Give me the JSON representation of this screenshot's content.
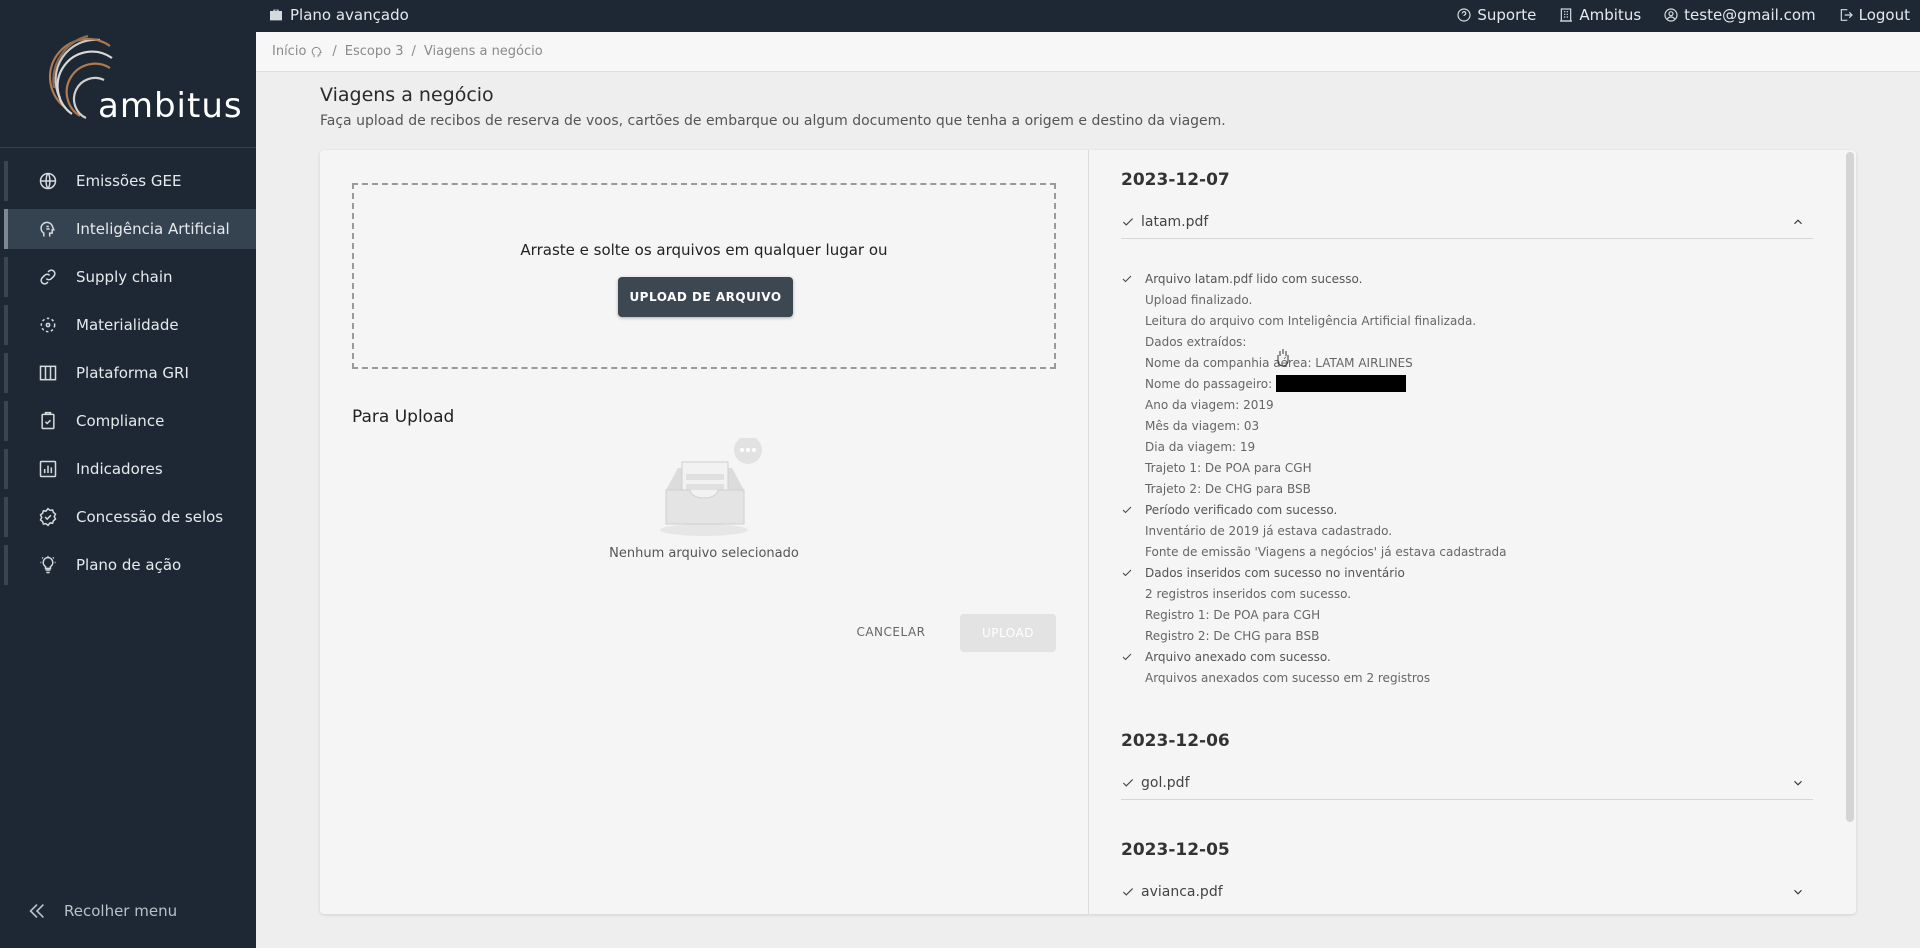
{
  "topbar": {
    "plan": "Plano avançado",
    "links": [
      {
        "label": "Suporte",
        "icon": "help-circle-icon"
      },
      {
        "label": "Ambitus",
        "icon": "building-icon"
      },
      {
        "label": "teste@gmail.com",
        "icon": "user-circle-icon"
      },
      {
        "label": "Logout",
        "icon": "logout-icon"
      }
    ]
  },
  "sidebar": {
    "logo": "ambitus",
    "items": [
      {
        "label": "Emissões GEE",
        "icon": "globe-icon"
      },
      {
        "label": "Inteligência Artificial",
        "icon": "ai-head-icon"
      },
      {
        "label": "Supply chain",
        "icon": "link-icon"
      },
      {
        "label": "Materialidade",
        "icon": "target-icon"
      },
      {
        "label": "Plataforma GRI",
        "icon": "columns-icon"
      },
      {
        "label": "Compliance",
        "icon": "clipboard-icon"
      },
      {
        "label": "Indicadores",
        "icon": "bar-chart-icon"
      },
      {
        "label": "Concessão de selos",
        "icon": "badge-check-icon"
      },
      {
        "label": "Plano de ação",
        "icon": "lightbulb-icon"
      }
    ],
    "collapse_label": "Recolher menu"
  },
  "breadcrumb": {
    "home": "Início",
    "scope": "Escopo 3",
    "current": "Viagens a negócio"
  },
  "page": {
    "title": "Viagens a negócio",
    "subtitle": "Faça upload de recibos de reserva de voos, cartões de embarque ou algum documento que tenha a origem e destino da viagem."
  },
  "upload": {
    "drop_text": "Arraste e solte os arquivos em qualquer lugar ou",
    "button_label": "UPLOAD DE ARQUIVO",
    "section_title": "Para Upload",
    "empty_text": "Nenhum arquivo selecionado",
    "cancel_label": "CANCELAR",
    "upload_label": "UPLOAD"
  },
  "history": [
    {
      "date": "2023-12-07",
      "file": "latam.pdf",
      "log": [
        {
          "text": "Arquivo latam.pdf lido com sucesso.",
          "ok": true
        },
        {
          "text": "Upload finalizado.",
          "ok": false
        },
        {
          "text": "Leitura do arquivo com Inteligência Artificial finalizada.",
          "ok": false
        },
        {
          "text": "Dados extraídos:",
          "ok": false
        },
        {
          "text": "Nome da companhia aérea: LATAM AIRLINES",
          "ok": false
        },
        {
          "text": "Nome do passageiro:",
          "ok": false
        },
        {
          "text": "Ano da viagem: 2019",
          "ok": false
        },
        {
          "text": "Mês da viagem: 03",
          "ok": false
        },
        {
          "text": "Dia da viagem: 19",
          "ok": false
        },
        {
          "text": "Trajeto 1: De POA para CGH",
          "ok": false
        },
        {
          "text": "Trajeto 2: De CHG para BSB",
          "ok": false
        },
        {
          "text": "Período verificado com sucesso.",
          "ok": true
        },
        {
          "text": "Inventário de 2019 já estava cadastrado.",
          "ok": false
        },
        {
          "text": "Fonte de emissão 'Viagens a negócios' já estava cadastrada",
          "ok": false
        },
        {
          "text": "Dados inseridos com sucesso no inventário",
          "ok": true
        },
        {
          "text": "2 registros inseridos com sucesso.",
          "ok": false
        },
        {
          "text": "Registro 1: De POA para CGH",
          "ok": false
        },
        {
          "text": "Registro 2: De CHG para BSB",
          "ok": false
        },
        {
          "text": "Arquivo anexado com sucesso.",
          "ok": true
        },
        {
          "text": "Arquivos anexados com sucesso em 2 registros",
          "ok": false
        }
      ]
    },
    {
      "date": "2023-12-06",
      "file": "gol.pdf"
    },
    {
      "date": "2023-12-05",
      "file": "avianca.pdf"
    }
  ]
}
